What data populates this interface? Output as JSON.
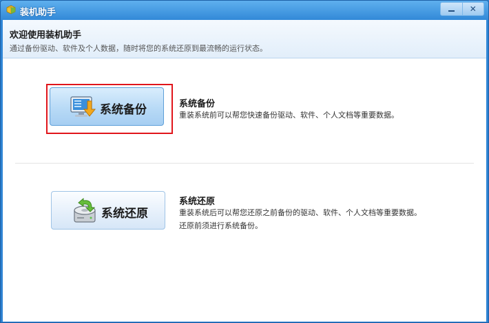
{
  "window": {
    "title": "装机助手",
    "controls": {
      "minimize": "—",
      "close": "✕"
    }
  },
  "header": {
    "title": "欢迎使用装机助手",
    "subtitle": "通过备份驱动、软件及个人数据，随时将您的系统还原到最流畅的运行状态。"
  },
  "backup": {
    "label": "系统备份",
    "title": "系统备份",
    "description": "重装系统前可以帮您快速备份驱动、软件、个人文档等重要数据。",
    "icon": "monitor-download-icon"
  },
  "restore": {
    "label": "系统还原",
    "title": "系统还原",
    "description_line1": "重装系统后可以帮您还原之前备份的驱动、软件、个人文档等重要数据。",
    "description_line2": "还原前须进行系统备份。",
    "icon": "disk-restore-icon"
  },
  "colors": {
    "titlebar": "#2f86d6",
    "highlight": "#e0141a",
    "button_border": "#9ec3e6"
  }
}
